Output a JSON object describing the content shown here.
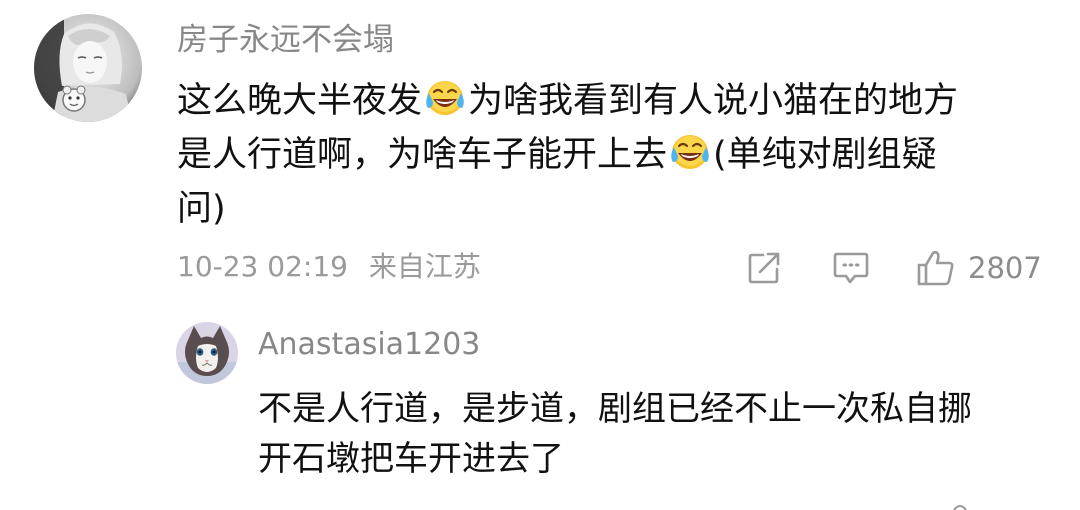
{
  "comment": {
    "username": "房子永远不会塌",
    "text_line_1_part_1": "这么晚大半夜发",
    "text_line_1_part_2": "为啥我看到有人说小猫在的地方",
    "text_line_2_part_1": "是人行道啊，为啥车子能开上去",
    "text_line_2_part_2": "(单纯对剧组疑",
    "text_line_3": "问)",
    "time": "10-23 02:19",
    "location": "来自江苏",
    "like_count": "2807",
    "emoji_icon": "laughing-tears-emoji"
  },
  "reply": {
    "username": "Anastasia1203",
    "text_line_1": "不是人行道，是步道，剧组已经不止一次私自挪",
    "text_line_2": "开石墩把车开进去了"
  },
  "colors": {
    "text": "#111111",
    "secondary": "#888888",
    "icon": "#9a9a9a",
    "background": "#ffffff"
  }
}
